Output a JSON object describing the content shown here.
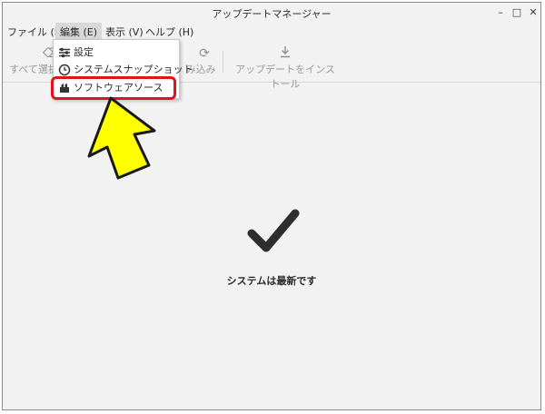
{
  "window": {
    "title": "アップデートマネージャー",
    "controls": {
      "minimize": "–",
      "maximize": "□",
      "close": "✕"
    }
  },
  "menubar": {
    "items": [
      {
        "label": "ファイル (F)"
      },
      {
        "label": "編集 (E)"
      },
      {
        "label": "表示 (V)"
      },
      {
        "label": "ヘルプ (H)"
      }
    ]
  },
  "toolbar": {
    "clear_label": "すべて選択",
    "refresh_label": "み込み",
    "install_label": "アップデートをインストール"
  },
  "edit_menu": {
    "items": [
      {
        "label": "設定",
        "icon": "settings-icon"
      },
      {
        "label": "システムスナップショット",
        "icon": "clock-icon"
      },
      {
        "label": "ソフトウェアソース",
        "icon": "software-sources-icon"
      }
    ]
  },
  "annotation": {
    "highlight_color": "#e0141a",
    "arrow_color": "#ffff00"
  },
  "status": {
    "message": "システムは最新です"
  }
}
